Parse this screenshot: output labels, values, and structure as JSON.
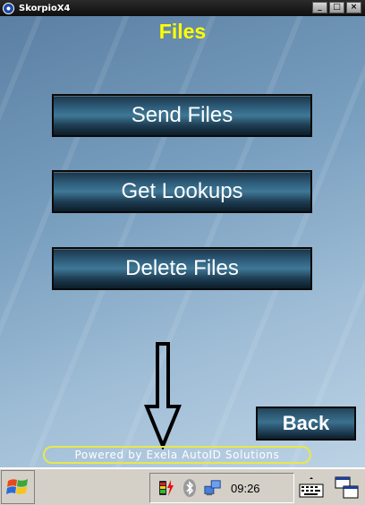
{
  "window": {
    "title": "SkorpioX4",
    "controls": [
      "_",
      "□",
      "×"
    ]
  },
  "page": {
    "title": "Files"
  },
  "menu": {
    "send_files": "Send Files",
    "get_lookups": "Get Lookups",
    "delete_files": "Delete Files"
  },
  "back_label": "Back",
  "footer": {
    "powered_by": "Powered by Exela AutoID Solutions"
  },
  "taskbar": {
    "clock": "09:26"
  },
  "colors": {
    "title_yellow": "#ffff00",
    "highlight_ring": "#e8e84a"
  }
}
